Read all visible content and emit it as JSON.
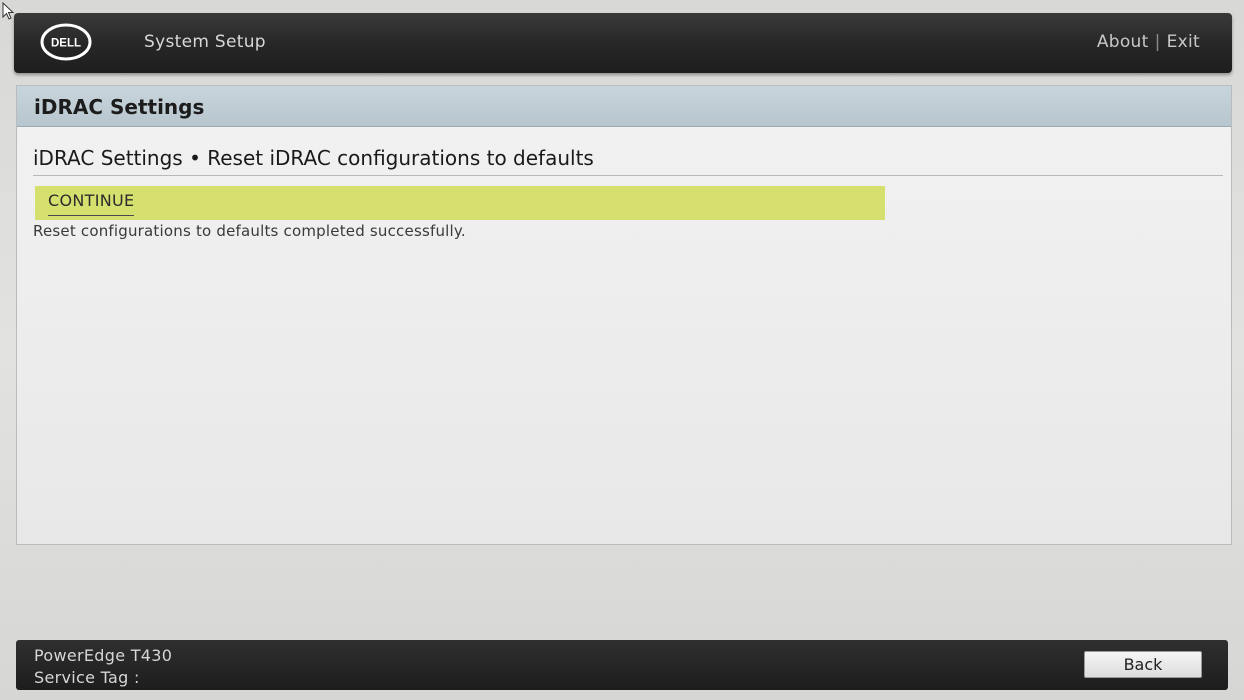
{
  "header": {
    "logo_text": "DELL",
    "app_title": "System Setup",
    "about_label": "About",
    "separator": "|",
    "exit_label": "Exit"
  },
  "panel": {
    "title": "iDRAC Settings",
    "breadcrumb": "iDRAC Settings • Reset iDRAC configurations to defaults",
    "continue_label": "CONTINUE",
    "status_message": "Reset configurations to defaults completed successfully."
  },
  "footer": {
    "model": "PowerEdge T430",
    "service_tag_label": "Service Tag :",
    "back_label": "Back"
  },
  "colors": {
    "highlight": "#d6e06e",
    "topbar": "#262626",
    "panel_header": "#bfcbd3"
  }
}
